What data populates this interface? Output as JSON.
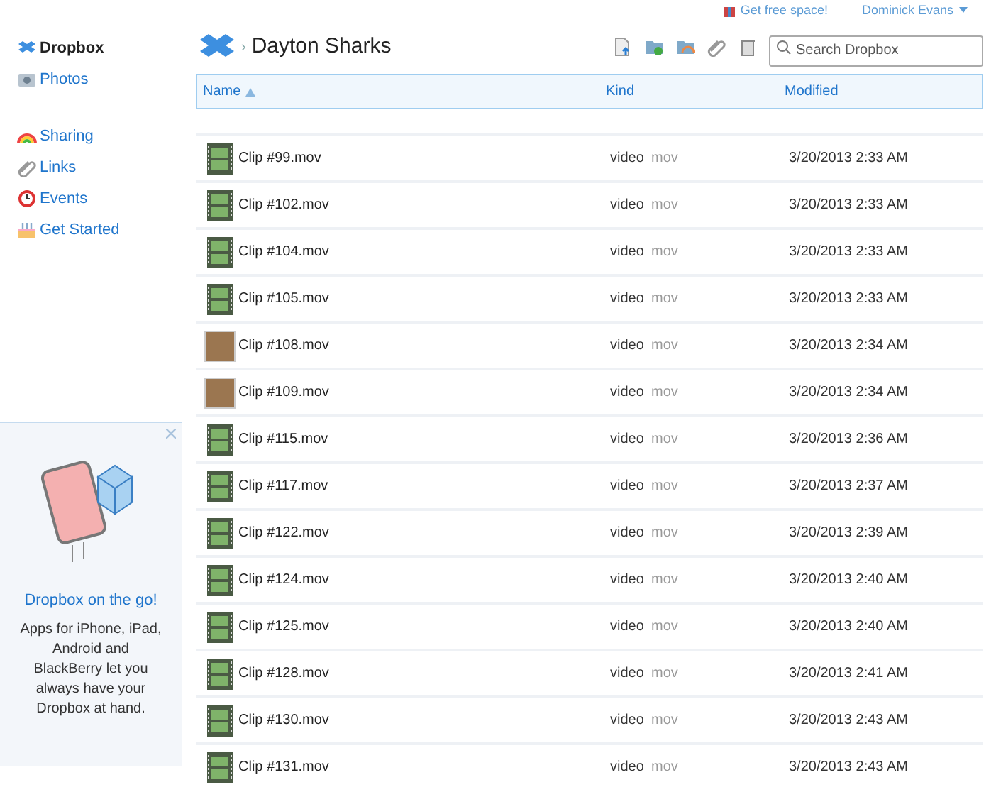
{
  "top_links": [
    {
      "label": "Get free space!",
      "kind": "gift"
    },
    {
      "label": "Dominick Evans",
      "kind": "account"
    }
  ],
  "sidebar": {
    "items": [
      {
        "label": "Dropbox",
        "selected": true,
        "kind": "box"
      },
      {
        "label": "Photos",
        "selected": false,
        "kind": "photo"
      },
      {
        "label": "Sharing",
        "selected": false,
        "kind": "rainbow"
      },
      {
        "label": "Links",
        "selected": false,
        "kind": "link"
      },
      {
        "label": "Events",
        "selected": false,
        "kind": "clock"
      },
      {
        "label": "Get Started",
        "selected": false,
        "kind": "cake"
      }
    ]
  },
  "promo": {
    "title": "Dropbox on the go!",
    "text": "Apps for iPhone, iPad, Android and BlackBerry let you always have your Dropbox at hand."
  },
  "breadcrumb": {
    "separator": "›",
    "title": "Dayton Sharks"
  },
  "search": {
    "placeholder": "Search Dropbox"
  },
  "table": {
    "columns": [
      {
        "label": "Name",
        "sorted": true
      },
      {
        "label": "Kind",
        "sorted": false
      },
      {
        "label": "Modified",
        "sorted": false
      }
    ],
    "rows": [
      {
        "name": "Clip #99.mov",
        "kind": "film",
        "file_type": "video",
        "ext": "mov",
        "modified": "3/20/2013 2:33 AM"
      },
      {
        "name": "Clip #102.mov",
        "kind": "film",
        "file_type": "video",
        "ext": "mov",
        "modified": "3/20/2013 2:33 AM"
      },
      {
        "name": "Clip #104.mov",
        "kind": "film",
        "file_type": "video",
        "ext": "mov",
        "modified": "3/20/2013 2:33 AM"
      },
      {
        "name": "Clip #105.mov",
        "kind": "film",
        "file_type": "video",
        "ext": "mov",
        "modified": "3/20/2013 2:33 AM"
      },
      {
        "name": "Clip #108.mov",
        "kind": "photo",
        "file_type": "video",
        "ext": "mov",
        "modified": "3/20/2013 2:34 AM"
      },
      {
        "name": "Clip #109.mov",
        "kind": "photo",
        "file_type": "video",
        "ext": "mov",
        "modified": "3/20/2013 2:34 AM"
      },
      {
        "name": "Clip #115.mov",
        "kind": "film",
        "file_type": "video",
        "ext": "mov",
        "modified": "3/20/2013 2:36 AM"
      },
      {
        "name": "Clip #117.mov",
        "kind": "film",
        "file_type": "video",
        "ext": "mov",
        "modified": "3/20/2013 2:37 AM"
      },
      {
        "name": "Clip #122.mov",
        "kind": "film",
        "file_type": "video",
        "ext": "mov",
        "modified": "3/20/2013 2:39 AM"
      },
      {
        "name": "Clip #124.mov",
        "kind": "film",
        "file_type": "video",
        "ext": "mov",
        "modified": "3/20/2013 2:40 AM"
      },
      {
        "name": "Clip #125.mov",
        "kind": "film",
        "file_type": "video",
        "ext": "mov",
        "modified": "3/20/2013 2:40 AM"
      },
      {
        "name": "Clip #128.mov",
        "kind": "film",
        "file_type": "video",
        "ext": "mov",
        "modified": "3/20/2013 2:41 AM"
      },
      {
        "name": "Clip #130.mov",
        "kind": "film",
        "file_type": "video",
        "ext": "mov",
        "modified": "3/20/2013 2:43 AM"
      },
      {
        "name": "Clip #131.mov",
        "kind": "film",
        "file_type": "video",
        "ext": "mov",
        "modified": "3/20/2013 2:43 AM"
      }
    ]
  }
}
